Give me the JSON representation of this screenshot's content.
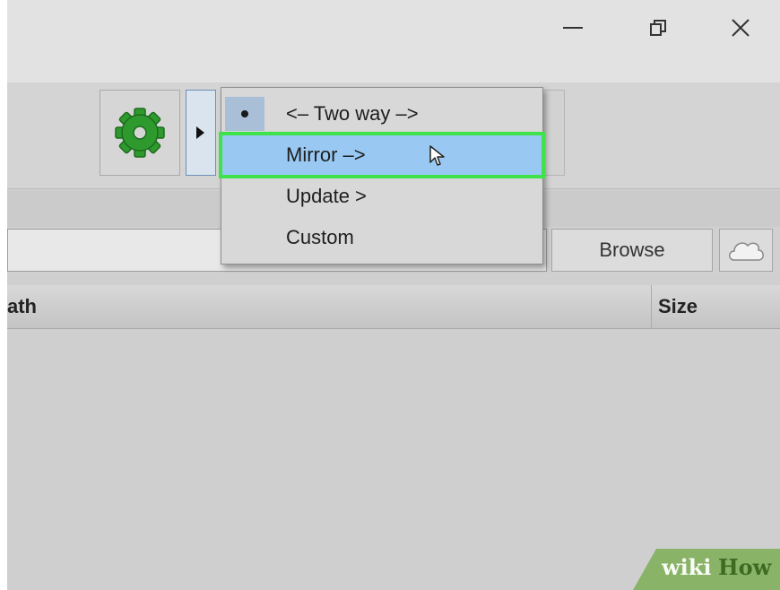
{
  "window_controls": {
    "minimize_icon": "minimize-icon",
    "restore_icon": "restore-icon",
    "close_icon": "close-icon"
  },
  "toolbar": {
    "sync_settings_icon": "gear-icon",
    "sync_variant_icon": "triangle-right-icon"
  },
  "sync_variant_menu": {
    "items": [
      {
        "label": "<– Two way –>",
        "selected": true,
        "highlighted": false
      },
      {
        "label": "Mirror –>",
        "selected": false,
        "highlighted": true
      },
      {
        "label": "Update >",
        "selected": false,
        "highlighted": false
      },
      {
        "label": "Custom",
        "selected": false,
        "highlighted": false
      }
    ]
  },
  "folder_row": {
    "browse_label": "Browse",
    "cloud_icon": "cloud-icon"
  },
  "file_table": {
    "columns": [
      "ath",
      "Size"
    ]
  },
  "watermark": {
    "part1": "wiki",
    "part2": "How"
  },
  "colors": {
    "highlight": "#99c9f3",
    "callout_border": "#3ee24a",
    "gear": "#2e9a2e"
  }
}
